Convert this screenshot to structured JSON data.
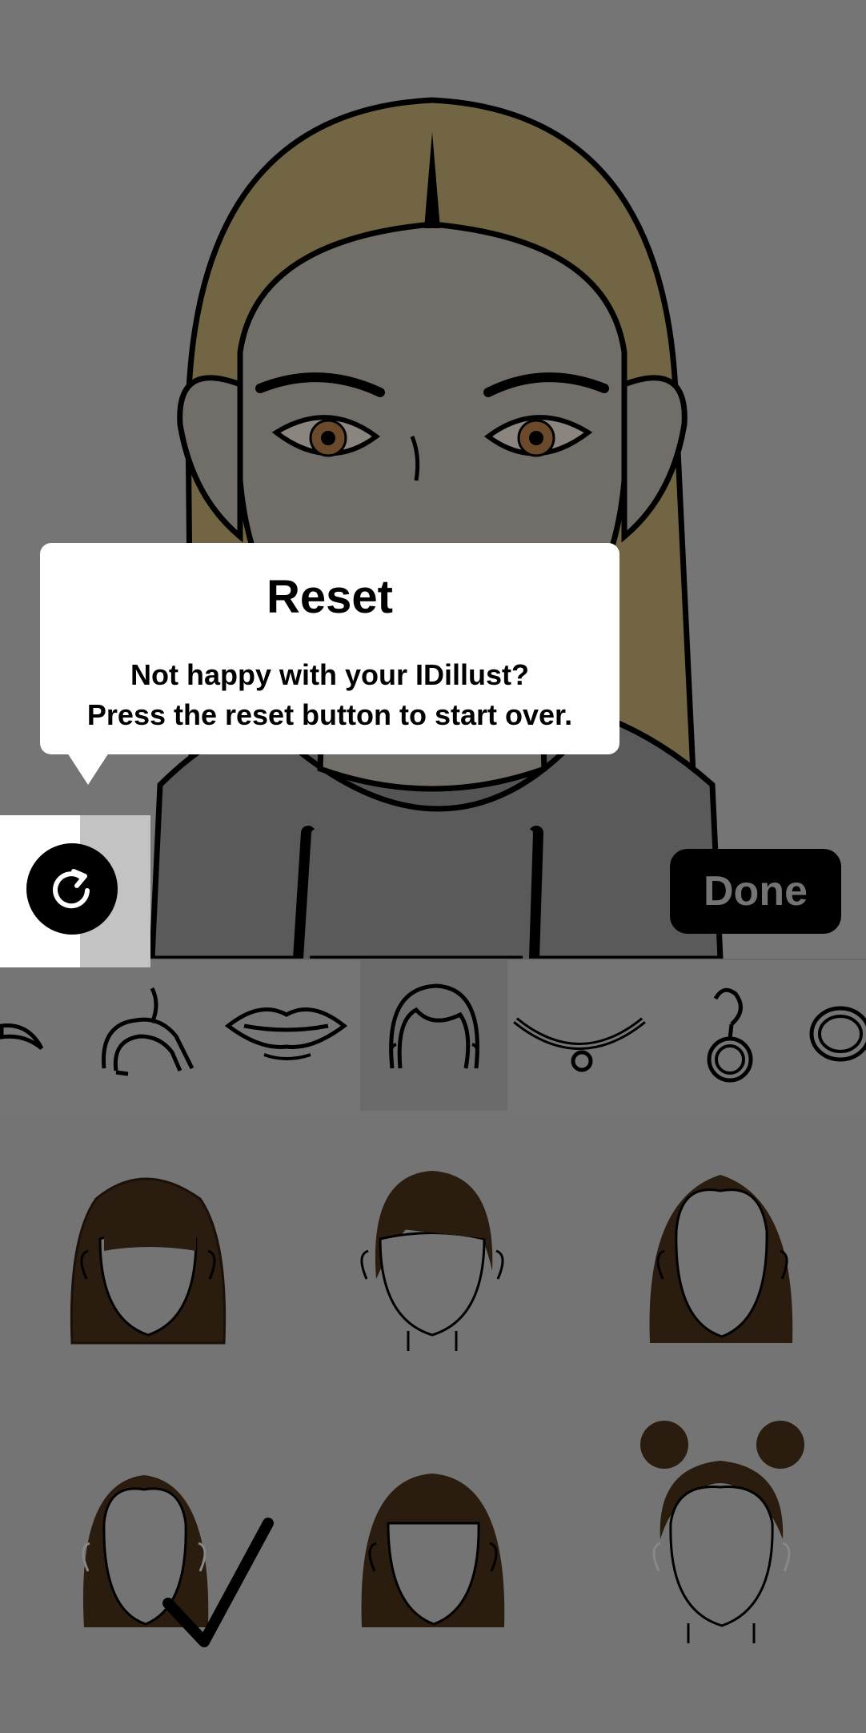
{
  "tooltip": {
    "title": "Reset",
    "line1": "Not happy with your IDillust?",
    "line2": "Press the reset button to start over."
  },
  "toolbar": {
    "reset_icon": "refresh-icon",
    "done_label": "Done"
  },
  "category_tabs": [
    {
      "icon": "eyebrow-icon",
      "selected": false
    },
    {
      "icon": "headband-icon",
      "selected": false
    },
    {
      "icon": "lips-icon",
      "selected": false
    },
    {
      "icon": "hair-icon",
      "selected": true
    },
    {
      "icon": "necklace-icon",
      "selected": false
    },
    {
      "icon": "earring-icon",
      "selected": false
    },
    {
      "icon": "ring-icon",
      "selected": false
    }
  ],
  "hair_options": [
    {
      "style": "bob-with-bangs",
      "selected": false
    },
    {
      "style": "short-side-swept",
      "selected": false
    },
    {
      "style": "medium-center-part",
      "selected": false
    },
    {
      "style": "long-center-part",
      "selected": true
    },
    {
      "style": "long-blunt-bangs",
      "selected": false
    },
    {
      "style": "space-buns",
      "selected": false
    }
  ],
  "colors": {
    "hair": "#716543",
    "skin": "#716d69",
    "hoodie": "#5a5a5a",
    "option_hair": "#2a1c0e",
    "overlay": "#757575"
  }
}
